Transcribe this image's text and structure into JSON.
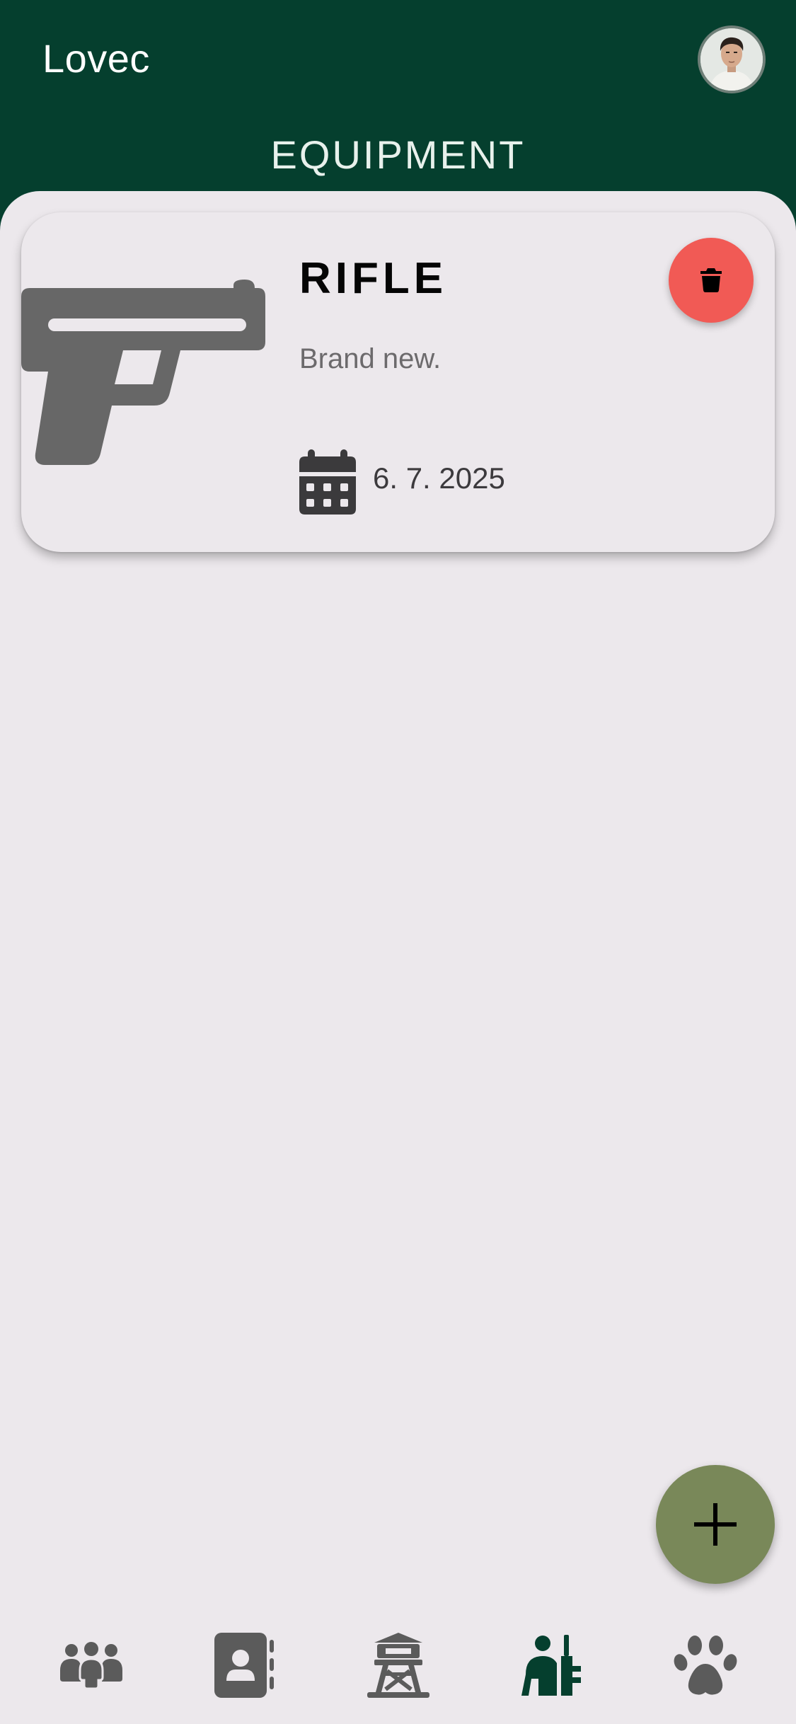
{
  "header": {
    "app_title": "Lovec",
    "page_title": "EQUIPMENT",
    "avatar_icon": "user-avatar"
  },
  "equipment": [
    {
      "name": "RIFLE",
      "description": "Brand new.",
      "date": "6. 7. 2025",
      "icon": "pistol-icon"
    }
  ],
  "actions": {
    "delete_icon": "trash-icon",
    "add_icon": "plus-icon"
  },
  "bottom_nav": {
    "active_index": 3,
    "items": [
      {
        "icon": "people-group-icon"
      },
      {
        "icon": "contact-book-icon"
      },
      {
        "icon": "watchtower-icon"
      },
      {
        "icon": "hunter-icon"
      },
      {
        "icon": "paw-icon"
      }
    ]
  },
  "colors": {
    "primary": "#053f2e",
    "background": "#ece8ec",
    "delete": "#f15a55",
    "fab": "#798859",
    "icon_gray": "#5a5a5a"
  }
}
